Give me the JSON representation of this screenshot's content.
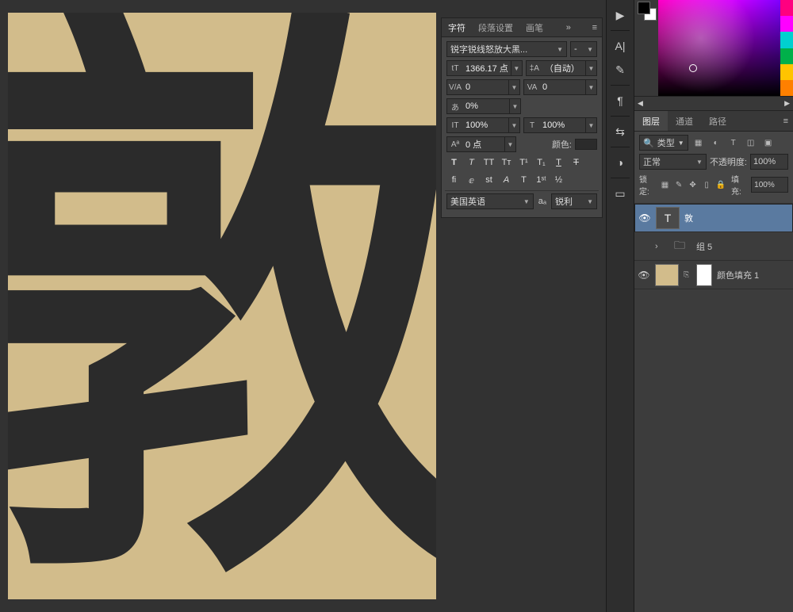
{
  "canvas": {
    "character": "敦"
  },
  "char_panel": {
    "tabs": {
      "char": "字符",
      "paragraph": "段落设置",
      "brush": "画笔"
    },
    "font_family": "锐字锐线怒放大黑...",
    "font_style": "-",
    "size_icon": "tT",
    "size": "1366.17 点",
    "leading_icon": "‡A",
    "leading": "（自动）",
    "va_label": "V/A",
    "tracking": "0",
    "va2_label": "VA",
    "tracking2": "0",
    "scale_icon": "あ",
    "vscale": "0%",
    "hlabel": "IT",
    "hscale": "100%",
    "vlabel": "T",
    "vscale2": "100%",
    "baseline_icon": "Aª",
    "baseline": "0 点",
    "color_label": "颜色:",
    "lang": "美国英语",
    "aa_label": "aₐ",
    "aa": "锐利"
  },
  "vtool": {
    "items": [
      "▶",
      "A|",
      "🖌",
      "¶",
      "⇄",
      "🌀",
      "▭"
    ]
  },
  "color_picker": {
    "swatches_hue": [
      "#ff0080",
      "#ff00ff",
      "#00ffff",
      "#00cc66",
      "#ffcc00",
      "#ff8000"
    ]
  },
  "layers_panel": {
    "tabs": {
      "layers": "图层",
      "channels": "通道",
      "paths": "路径"
    },
    "filter_label": "类型",
    "blend_mode": "正常",
    "opacity_label": "不透明度:",
    "opacity": "100%",
    "lock_label": "锁定:",
    "fill_label": "填充:",
    "fill": "100%",
    "layers": [
      {
        "name": "敦",
        "type": "text",
        "visible": true,
        "selected": true
      },
      {
        "name": "组 5",
        "type": "group",
        "visible": false,
        "selected": false
      },
      {
        "name": "颜色填充 1",
        "type": "fill",
        "visible": true,
        "selected": false
      }
    ]
  }
}
